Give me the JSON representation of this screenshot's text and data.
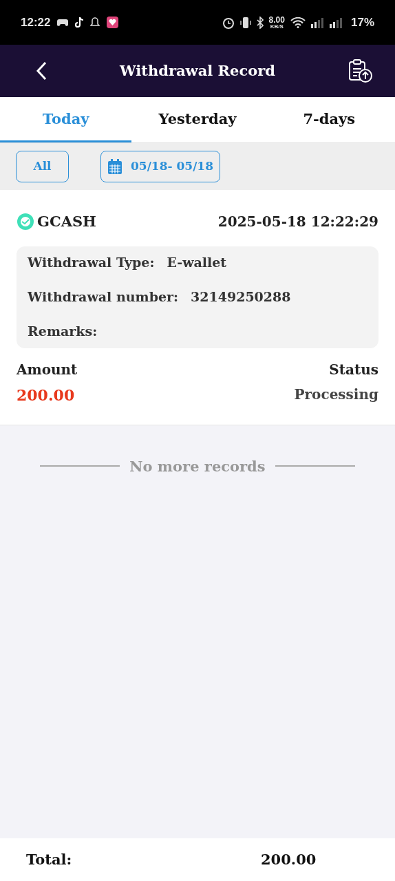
{
  "status_bar": {
    "time": "12:22",
    "speed": "8.00",
    "speed_unit": "KB/S",
    "battery": "17%"
  },
  "header": {
    "title": "Withdrawal Record"
  },
  "tabs": [
    {
      "label": "Today",
      "selected": true
    },
    {
      "label": "Yesterday",
      "selected": false
    },
    {
      "label": "7-days",
      "selected": false
    }
  ],
  "filters": {
    "type": "All",
    "date_range": "05/18- 05/18"
  },
  "records": [
    {
      "method": "GCASH",
      "datetime": "2025-05-18 12:22:29",
      "details": [
        {
          "label": "Withdrawal Type:",
          "value": "E-wallet"
        },
        {
          "label": "Withdrawal number:",
          "value": "32149250288"
        },
        {
          "label": "Remarks:"
        }
      ],
      "amount_label": "Amount",
      "amount": "200.00",
      "status_label": "Status",
      "status": "Processing"
    }
  ],
  "end_note": "No more records",
  "footer": {
    "total_label": "Total:",
    "total": "200.00"
  }
}
